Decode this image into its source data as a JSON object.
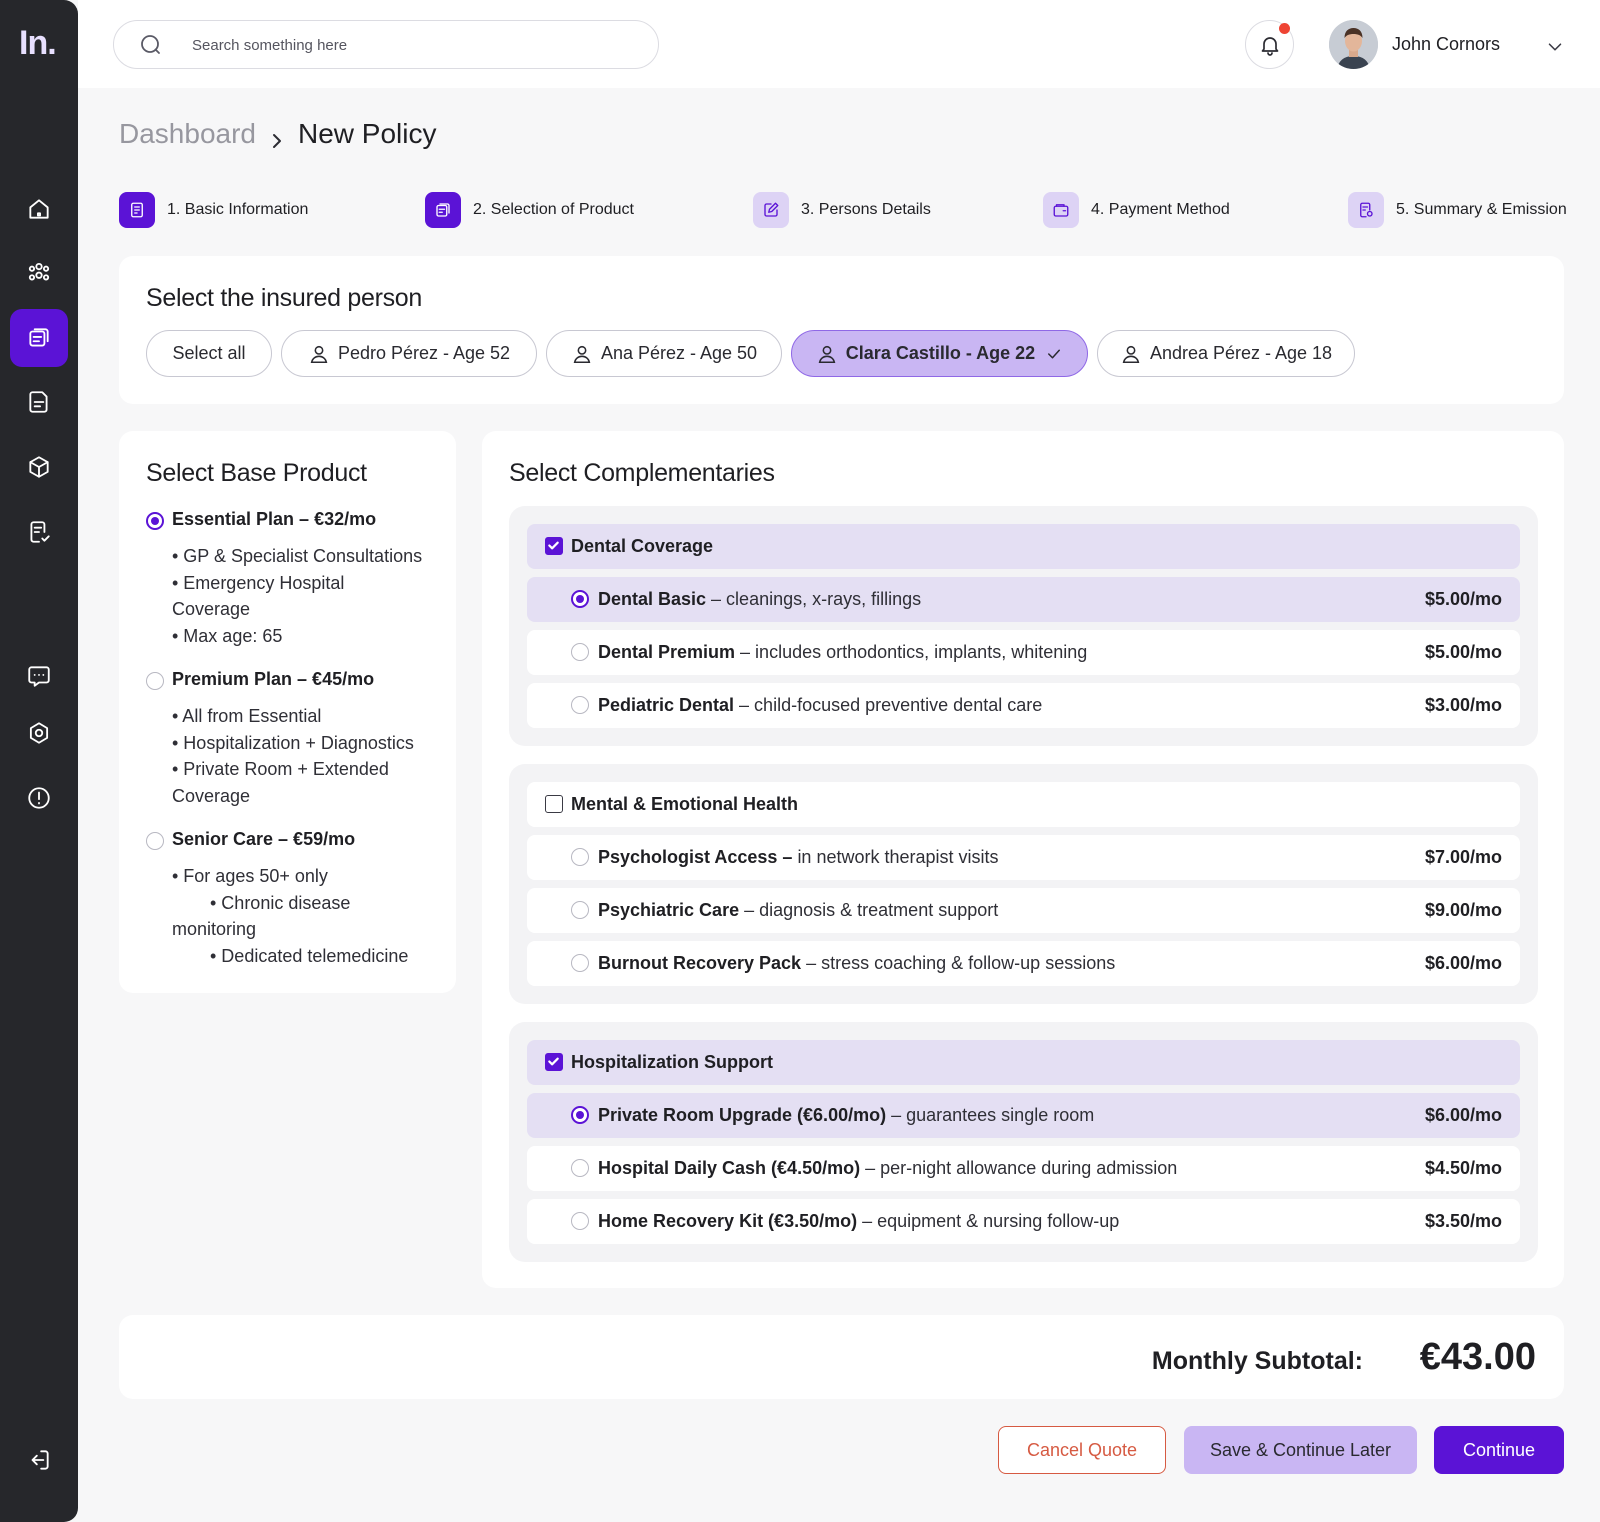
{
  "app": {
    "logo": "In."
  },
  "sidebar": {
    "items": [
      {
        "icon": "home-icon"
      },
      {
        "icon": "users-icon"
      },
      {
        "icon": "policy-icon",
        "active": true
      },
      {
        "icon": "document-icon"
      },
      {
        "icon": "box-icon"
      },
      {
        "icon": "report-icon"
      },
      {
        "icon": "chat-icon"
      },
      {
        "icon": "settings-icon"
      },
      {
        "icon": "alert-icon"
      },
      {
        "icon": "logout-icon"
      }
    ]
  },
  "header": {
    "search_placeholder": "Search something here",
    "user_name": "John Cornors"
  },
  "breadcrumb": {
    "parent": "Dashboard",
    "current": "New Policy"
  },
  "steps": [
    {
      "label": "1.  Basic Information",
      "state": "done"
    },
    {
      "label": "2.  Selection of Product",
      "state": "done"
    },
    {
      "label": "3.  Persons Details",
      "state": "todo"
    },
    {
      "label": "4.  Payment Method",
      "state": "todo"
    },
    {
      "label": "5.  Summary & Emission",
      "state": "todo"
    }
  ],
  "insured": {
    "title": "Select the insured person",
    "select_all": "Select all",
    "persons": [
      {
        "label": "Pedro Pérez - Age 52"
      },
      {
        "label": "Ana Pérez - Age 50"
      },
      {
        "label": "Clara Castillo - Age 22",
        "selected": true
      },
      {
        "label": "Andrea Pérez - Age 18"
      }
    ]
  },
  "base_product": {
    "title": "Select Base Product",
    "plans": [
      {
        "name": "Essential Plan – €32/mo",
        "selected": true,
        "features": [
          "• GP & Specialist Consultations",
          "• Emergency Hospital",
          "Coverage",
          "• Max age: 65"
        ]
      },
      {
        "name": "Premium Plan – €45/mo",
        "selected": false,
        "features": [
          "• All from Essential",
          "• Hospitalization + Diagnostics",
          "• Private Room + Extended",
          "Coverage"
        ]
      },
      {
        "name": "Senior Care – €59/mo",
        "selected": false,
        "features": [
          "• For ages 50+ only",
          "• Chronic disease",
          "monitoring",
          "• Dedicated telemedicine"
        ]
      }
    ]
  },
  "complementaries": {
    "title": "Select Complementaries",
    "groups": [
      {
        "name": "Dental Coverage",
        "checked": true,
        "options": [
          {
            "name": "Dental Basic",
            "desc": " – cleanings, x-rays, fillings",
            "price": "$5.00/mo",
            "selected": true
          },
          {
            "name": "Dental Premium",
            "desc": " – includes orthodontics, implants, whitening",
            "price": "$5.00/mo",
            "selected": false
          },
          {
            "name": "Pediatric Dental",
            "desc": " – child-focused preventive dental care",
            "price": "$3.00/mo",
            "selected": false
          }
        ]
      },
      {
        "name": "Mental & Emotional Health",
        "checked": false,
        "options": [
          {
            "name": "Psychologist Access – ",
            "desc": "in network therapist visits",
            "price": "$7.00/mo",
            "selected": false
          },
          {
            "name": "Psychiatric Care",
            "desc": " – diagnosis & treatment support",
            "price": "$9.00/mo",
            "selected": false
          },
          {
            "name": "Burnout Recovery Pack",
            "desc": " – stress coaching & follow-up sessions",
            "price": "$6.00/mo",
            "selected": false
          }
        ]
      },
      {
        "name": "Hospitalization Support",
        "checked": true,
        "options": [
          {
            "name": "Private Room Upgrade (€6.00/mo)",
            "desc": " – guarantees single room",
            "price": "$6.00/mo",
            "selected": true
          },
          {
            "name": "Hospital Daily Cash (€4.50/mo)",
            "desc": " – per-night allowance during admission",
            "price": "$4.50/mo",
            "selected": false
          },
          {
            "name": "Home Recovery Kit (€3.50/mo)",
            "desc": " – equipment & nursing follow-up",
            "price": "$3.50/mo",
            "selected": false
          }
        ]
      }
    ]
  },
  "summary": {
    "label": "Monthly Subtotal:",
    "value": "€43.00"
  },
  "actions": {
    "cancel": "Cancel Quote",
    "save": "Save & Continue Later",
    "continue": "Continue"
  },
  "colors": {
    "accent": "#5b13d6",
    "accent_soft": "#c9b6f3",
    "sidebar": "#26272b",
    "danger": "#d65a42"
  }
}
